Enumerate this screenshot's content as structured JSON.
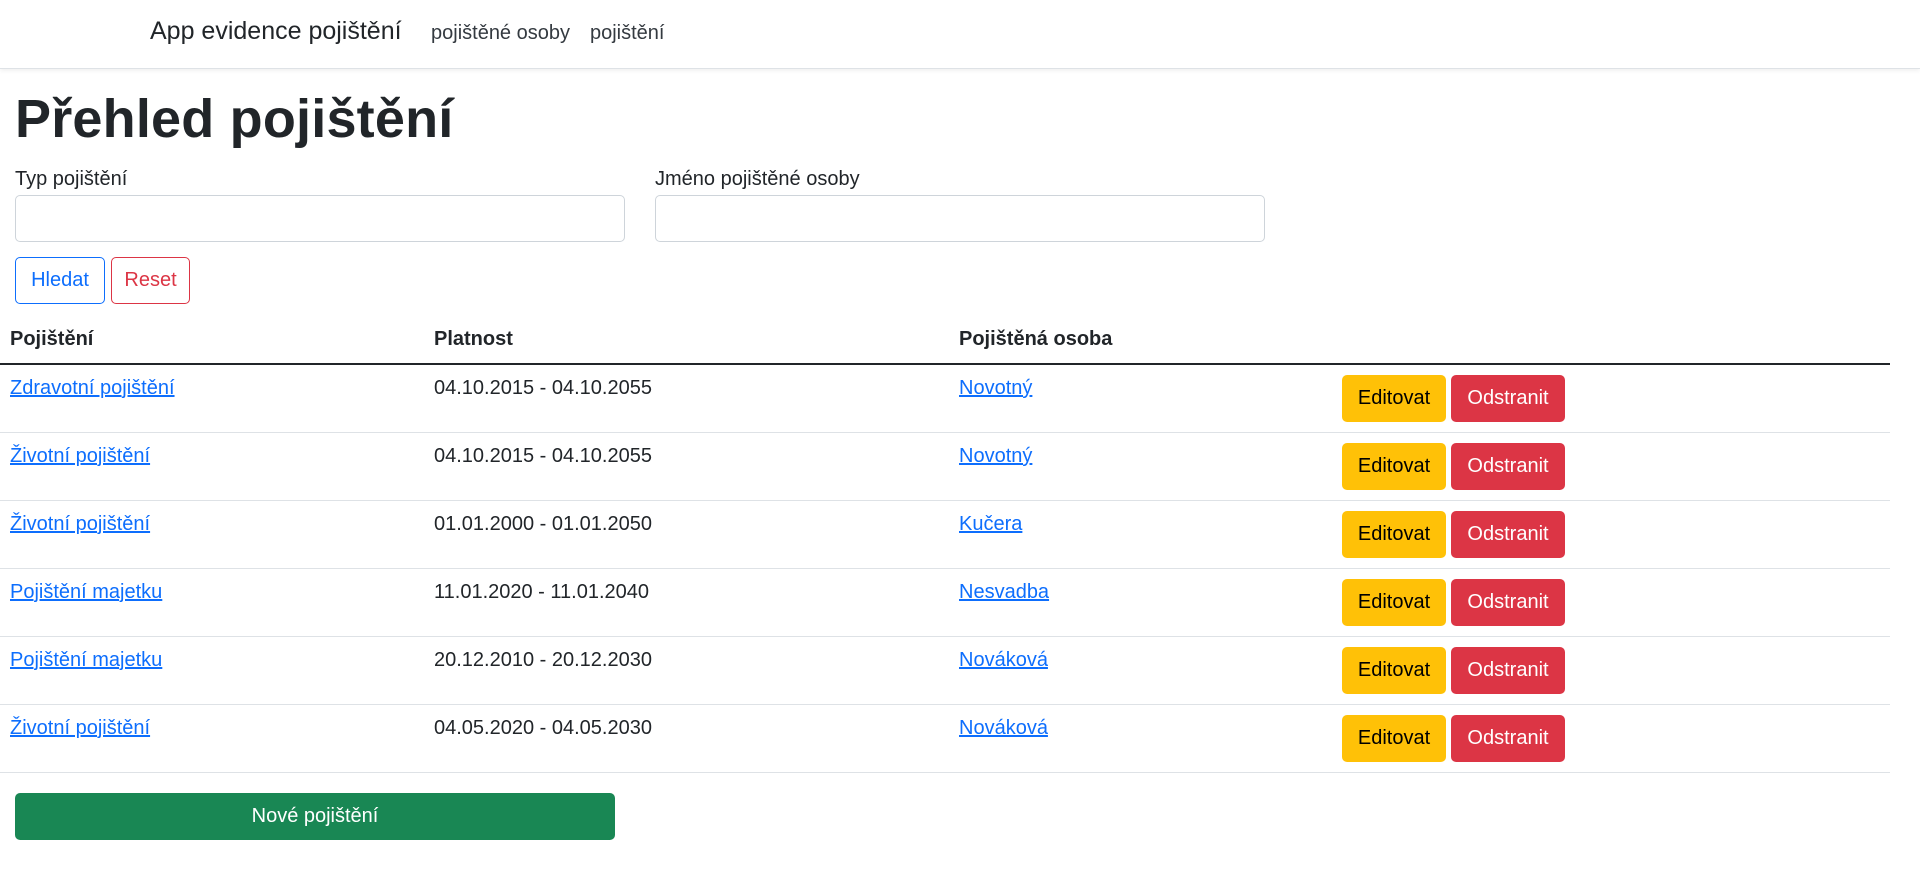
{
  "navbar": {
    "brand": "App evidence pojištění",
    "links": [
      {
        "label": "pojištěné osoby"
      },
      {
        "label": "pojištění"
      }
    ]
  },
  "page": {
    "title": "Přehled pojištění"
  },
  "filters": {
    "type_label": "Typ pojištění",
    "type_value": "",
    "name_label": "Jméno pojištěné osoby",
    "name_value": "",
    "search_label": "Hledat",
    "reset_label": "Reset"
  },
  "table": {
    "columns": [
      "Pojištění",
      "Platnost",
      "Pojištěná osoba"
    ],
    "rows": [
      {
        "insurance": "Zdravotní pojištění",
        "validity": "04.10.2015 - 04.10.2055",
        "person": "Novotný"
      },
      {
        "insurance": "Životní pojištění",
        "validity": "04.10.2015 - 04.10.2055",
        "person": "Novotný"
      },
      {
        "insurance": "Životní pojištění",
        "validity": "01.01.2000 - 01.01.2050",
        "person": "Kučera"
      },
      {
        "insurance": "Pojištění majetku",
        "validity": "11.01.2020 - 11.01.2040",
        "person": "Nesvadba"
      },
      {
        "insurance": "Pojištění majetku",
        "validity": "20.12.2010 - 20.12.2030",
        "person": "Nováková"
      },
      {
        "insurance": "Životní pojištění",
        "validity": "04.05.2020 - 04.05.2030",
        "person": "Nováková"
      }
    ],
    "edit_label": "Editovat",
    "delete_label": "Odstranit"
  },
  "actions": {
    "new_label": "Nové pojištění"
  },
  "colors": {
    "primary": "#0d6efd",
    "danger": "#dc3545",
    "warning": "#ffc107",
    "success": "#198754"
  }
}
